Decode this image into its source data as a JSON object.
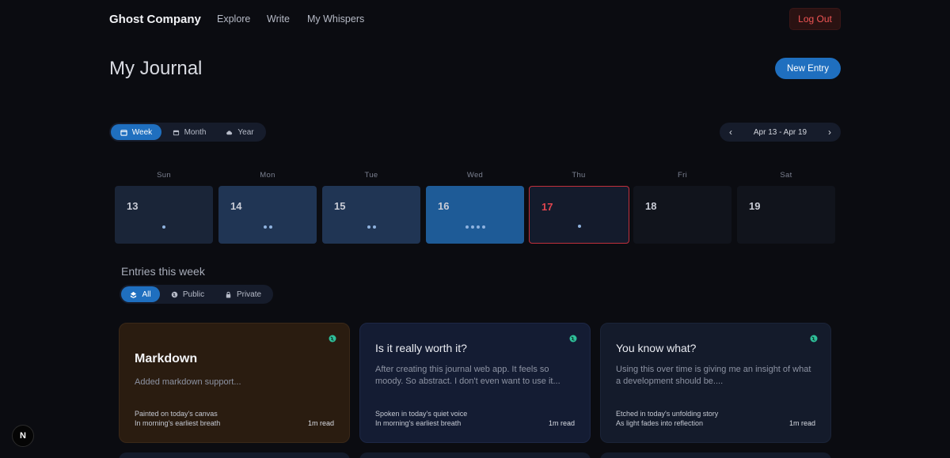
{
  "nav": {
    "brand": "Ghost Company",
    "links": [
      "Explore",
      "Write",
      "My Whispers"
    ],
    "logout": "Log Out"
  },
  "header": {
    "title": "My Journal",
    "new_entry": "New Entry"
  },
  "view_toggle": [
    {
      "label": "Week",
      "icon": "calendar-week-icon",
      "active": true
    },
    {
      "label": "Month",
      "icon": "calendar-month-icon",
      "active": false
    },
    {
      "label": "Year",
      "icon": "cloud-icon",
      "active": false
    }
  ],
  "range": {
    "label": "Apr 13 - Apr 19",
    "prev_icon": "chevron-left-icon",
    "next_icon": "chevron-right-icon"
  },
  "week": {
    "weekdays": [
      "Sun",
      "Mon",
      "Tue",
      "Wed",
      "Thu",
      "Fri",
      "Sat"
    ],
    "days": [
      {
        "num": "13",
        "entries": 1
      },
      {
        "num": "14",
        "entries": 2
      },
      {
        "num": "15",
        "entries": 2
      },
      {
        "num": "16",
        "entries": 4
      },
      {
        "num": "17",
        "entries": 1,
        "today": true
      },
      {
        "num": "18",
        "entries": 0
      },
      {
        "num": "19",
        "entries": 0
      }
    ]
  },
  "entries": {
    "title": "Entries this week",
    "filters": [
      {
        "label": "All",
        "icon": "stack-icon",
        "active": true
      },
      {
        "label": "Public",
        "icon": "globe-icon",
        "active": false
      },
      {
        "label": "Private",
        "icon": "lock-icon",
        "active": false
      }
    ],
    "cards": [
      {
        "title": "Markdown",
        "excerpt": "Added markdown support...",
        "foot1": "Painted on today's canvas",
        "foot2": "In morning's earliest breath",
        "read": "1m read"
      },
      {
        "title": "Is it really worth it?",
        "excerpt": "After creating this journal web app. It feels so moody. So abstract. I don't even want to use it...",
        "foot1": "Spoken in today's quiet voice",
        "foot2": "In morning's earliest breath",
        "read": "1m read"
      },
      {
        "title": "You know what?",
        "excerpt": "Using this over time is giving me an insight of what a development should be....",
        "foot1": "Etched in today's unfolding story",
        "foot2": "As light fades into reflection",
        "read": "1m read"
      }
    ]
  },
  "badge": "N",
  "colors": {
    "accent": "#1f6fbf",
    "today": "#e0454f",
    "logout": "#f05555",
    "globe": "#2fbf9a"
  }
}
